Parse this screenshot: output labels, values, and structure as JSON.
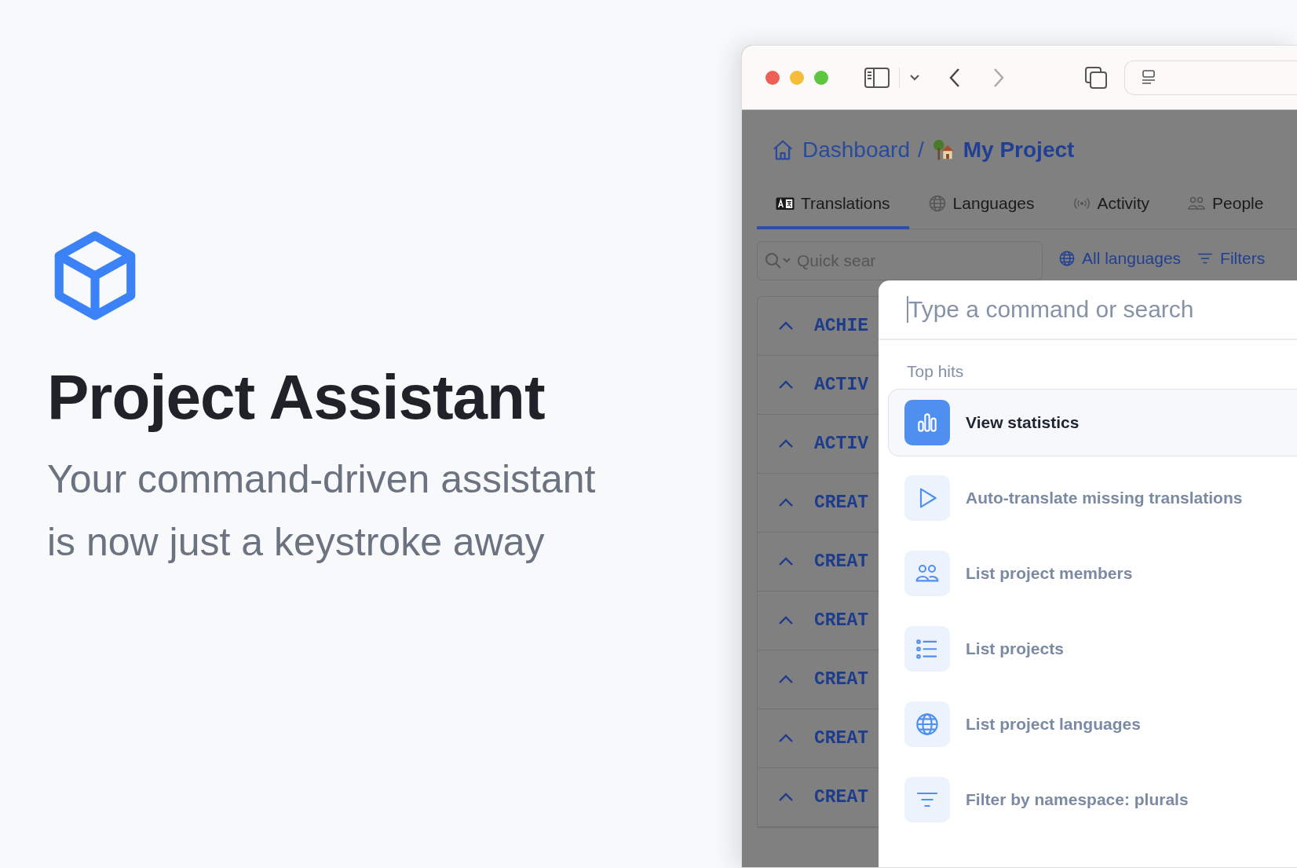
{
  "hero": {
    "title": "Project Assistant",
    "subtitle": "Your command-driven assistant is now just a keystroke away"
  },
  "browser": {
    "breadcrumb": [
      {
        "label": "Dashboard",
        "kind": "home"
      },
      {
        "label": "My Project",
        "kind": "project"
      }
    ],
    "separator": "/",
    "tabs": [
      {
        "label": "Translations",
        "kind": "translate",
        "selected": true
      },
      {
        "label": "Languages",
        "kind": "globe",
        "selected": false
      },
      {
        "label": "Activity",
        "kind": "broadcast",
        "selected": false
      },
      {
        "label": "People",
        "kind": "people",
        "selected": false
      }
    ],
    "search": {
      "placeholder": "Quick sear"
    },
    "toolbar": [
      {
        "label": "All languages",
        "kind": "globe"
      },
      {
        "label": "Filters",
        "kind": "filter"
      }
    ],
    "keys": [
      "ACHIE",
      "ACTIV",
      "ACTIV",
      "CREAT",
      "CREAT",
      "CREAT",
      "CREAT",
      "CREAT",
      "CREAT"
    ]
  },
  "palette": {
    "placeholder": "Type a command or search",
    "section": "Top hits",
    "items": [
      {
        "label": "View statistics",
        "kind": "chart",
        "selected": true
      },
      {
        "label": "Auto-translate missing translations",
        "kind": "play",
        "selected": false
      },
      {
        "label": "List project members",
        "kind": "people",
        "selected": false
      },
      {
        "label": "List projects",
        "kind": "list",
        "selected": false
      },
      {
        "label": "List project languages",
        "kind": "globe",
        "selected": false
      },
      {
        "label": "Filter by namespace: plurals",
        "kind": "filter",
        "selected": false
      }
    ]
  }
}
